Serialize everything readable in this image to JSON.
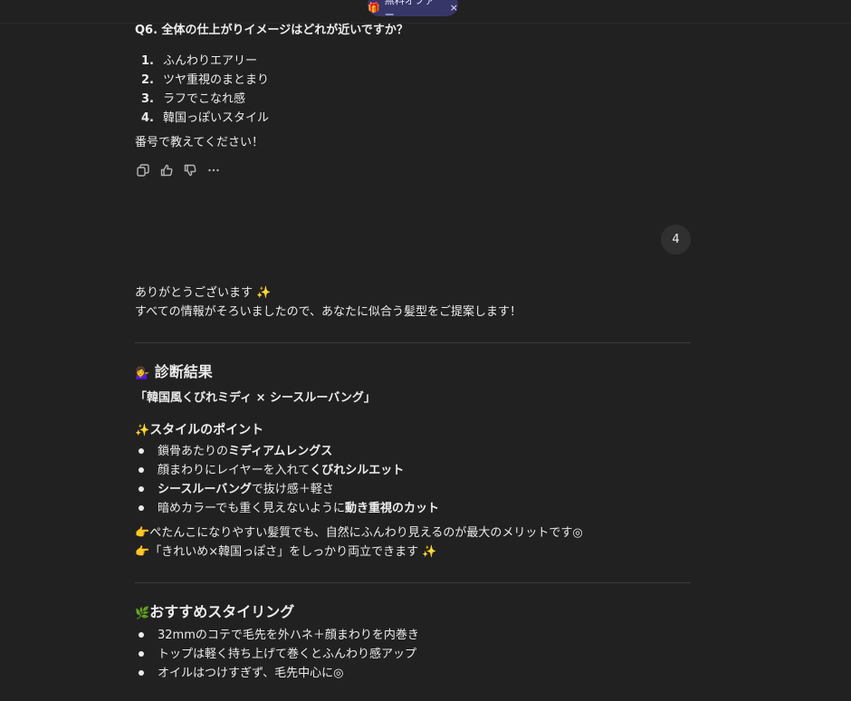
{
  "banner": {
    "offer_label": "無料オファー",
    "close": "×"
  },
  "question": {
    "heading": "Q6. 全体の仕上がりイメージはどれが近いですか？",
    "options": [
      {
        "n": "1.",
        "text": "ふんわりエアリー"
      },
      {
        "n": "2.",
        "text": "ツヤ重視のまとまり"
      },
      {
        "n": "3.",
        "text": "ラフでこなれ感"
      },
      {
        "n": "4.",
        "text": "韓国っぽいスタイル"
      }
    ],
    "prompt": "番号で教えてください！"
  },
  "actions": [
    "copy-icon",
    "thumbs-up-icon",
    "thumbs-down-icon",
    "more-icon"
  ],
  "user_reply": "4",
  "answer": {
    "thanks": "ありがとうございます",
    "sparkle": "✨",
    "intro": "すべての情報がそろいましたので、あなたに似合う髪型をご提案します！",
    "result_icon": "💁‍♀️",
    "result_title": "診断結果",
    "style_name": "「韓国風くびれミディ × シースルーバング」",
    "points_icon": "✨",
    "points_title": "スタイルのポイント",
    "points": [
      [
        {
          "t": "鎖骨あたりの",
          "b": false
        },
        {
          "t": "ミディアムレングス",
          "b": true
        }
      ],
      [
        {
          "t": "顔まわりにレイヤーを入れて",
          "b": false
        },
        {
          "t": "くびれシルエット",
          "b": true
        }
      ],
      [
        {
          "t": "シースルーバング",
          "b": true
        },
        {
          "t": "で抜け感＋軽さ",
          "b": false
        }
      ],
      [
        {
          "t": "暗めカラーでも重く見えないように",
          "b": false
        },
        {
          "t": "動き重視のカット",
          "b": true
        }
      ]
    ],
    "note_icon": "👉",
    "note1": "ぺたんこになりやすい髪質でも、自然にふんわり見えるのが最大のメリットです◎",
    "note2": "「きれいめ×韓国っぽさ」をしっかり両立できます",
    "note2_sparkle": "✨",
    "styling_icon": "🌿",
    "styling_title": "おすすめスタイリング",
    "styling": [
      "32mmのコテで毛先を外ハネ＋顔まわりを内巻き",
      "トップは軽く持ち上げて巻くとふんわり感アップ",
      "オイルはつけすぎず、毛先中心に◎"
    ]
  }
}
